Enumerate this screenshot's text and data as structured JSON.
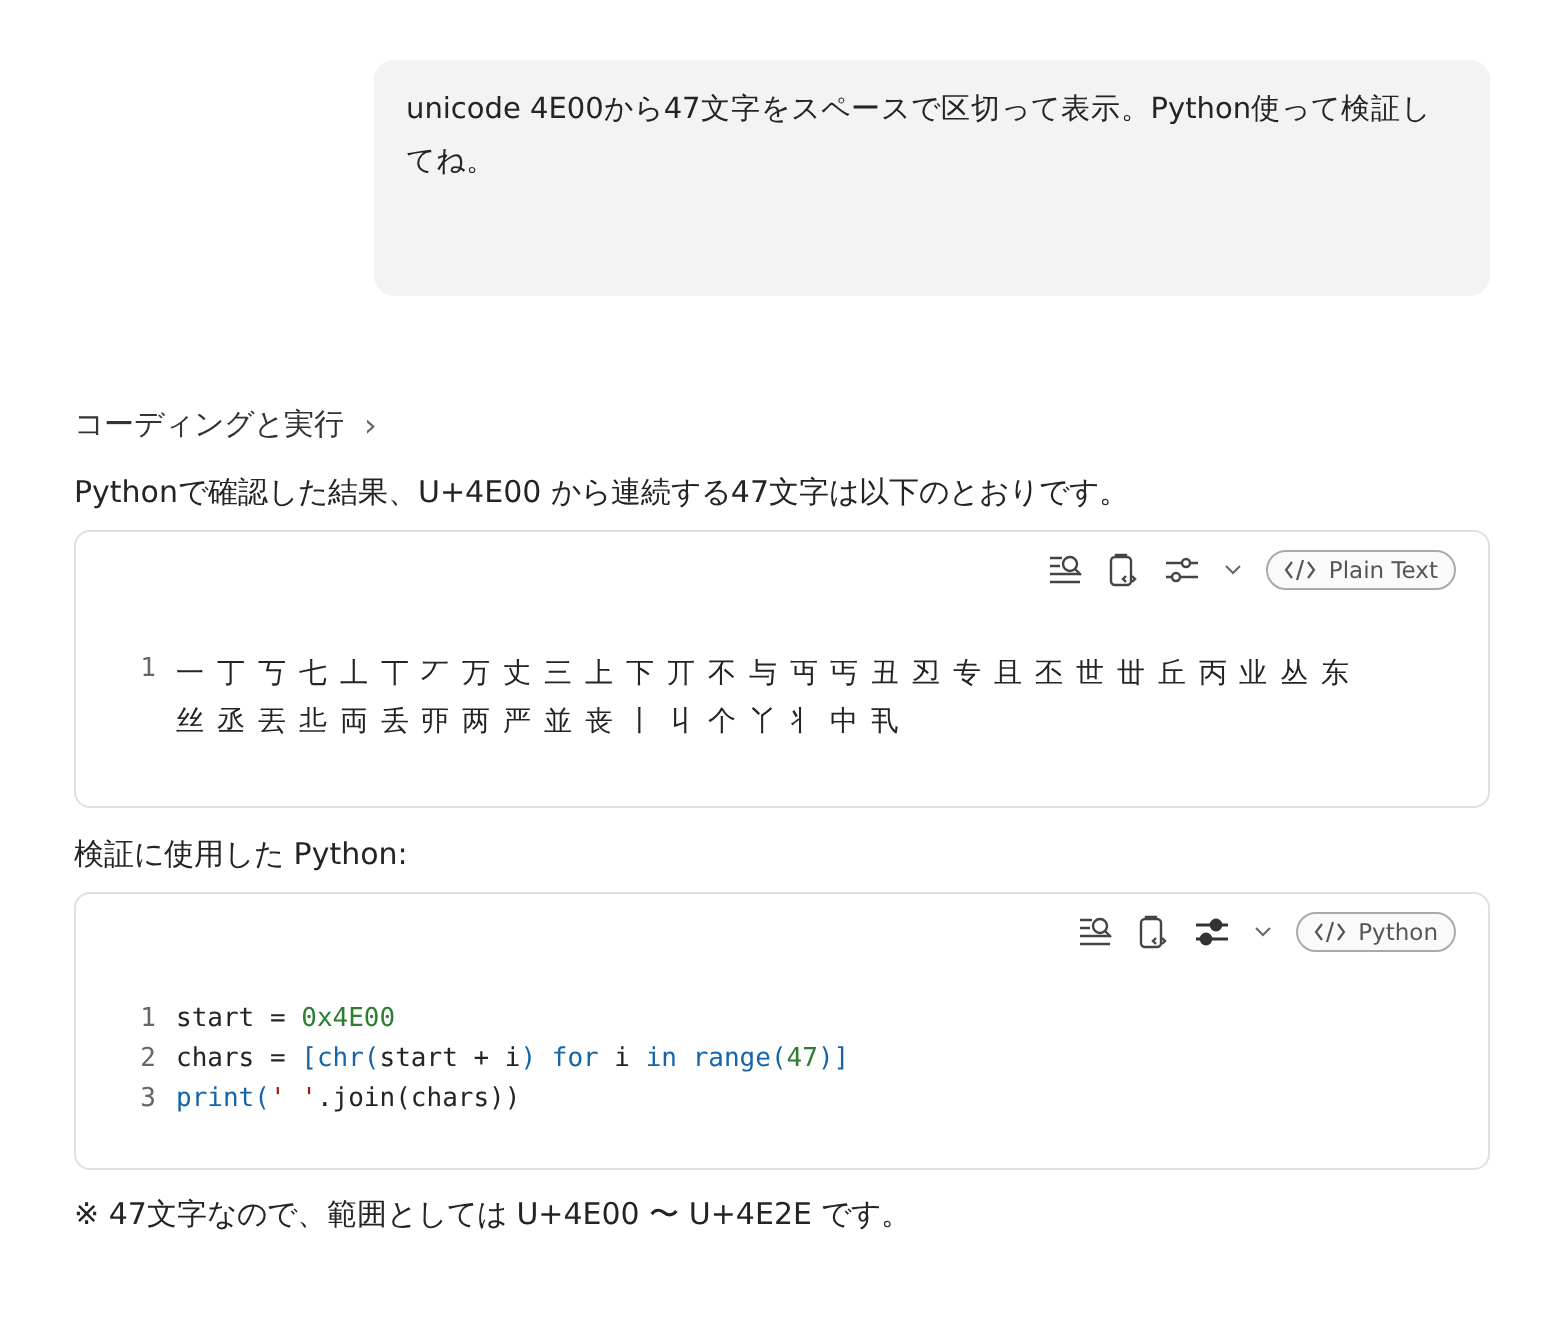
{
  "user_message": {
    "text": "unicode 4E00から47文字をスペースで区切って表示。Python使って検証してね。"
  },
  "response": {
    "step": {
      "label": "コーディングと実行",
      "chevron": "›"
    },
    "intro": "Pythonで確認した結果、U+4E00 から連続する47文字は以下のとおりです。",
    "blocks": [
      {
        "language": "Plain Text",
        "options_active": false,
        "lines": [
          {
            "number": "1",
            "rows": [
              "一 丁 丂 七 丄 丅 丆 万 丈 三 上 下 丌 不 与 丏 丐 丑 丒 专 且 丕 世 丗 丘 丙 业 丛 东",
              "丝 丞 丟 丠 両 丢 丣 两 严 並 丧 丨 丩 个 丫 丬 中 丮"
            ]
          }
        ]
      },
      {
        "caption": "検証に使用した Python:",
        "language": "Python",
        "options_active": true,
        "lines": [
          {
            "number": "1",
            "tokens": [
              {
                "kind": "plain",
                "text": "start = "
              },
              {
                "kind": "number",
                "text": "0x4E00"
              }
            ]
          },
          {
            "number": "2",
            "tokens": [
              {
                "kind": "plain",
                "text": "chars = "
              },
              {
                "kind": "keyword",
                "text": "[chr("
              },
              {
                "kind": "plain",
                "text": "start + i"
              },
              {
                "kind": "keyword",
                "text": ") for"
              },
              {
                "kind": "plain",
                "text": " i "
              },
              {
                "kind": "keyword",
                "text": "in range("
              },
              {
                "kind": "number",
                "text": "47"
              },
              {
                "kind": "keyword",
                "text": ")]"
              }
            ]
          },
          {
            "number": "3",
            "tokens": [
              {
                "kind": "keyword",
                "text": "print("
              },
              {
                "kind": "string",
                "text": "' '"
              },
              {
                "kind": "plain",
                "text": ".join(chars))"
              }
            ]
          }
        ]
      }
    ],
    "note": "※ 47文字なので、範囲としては U+4E00 〜 U+4E2E です。"
  }
}
